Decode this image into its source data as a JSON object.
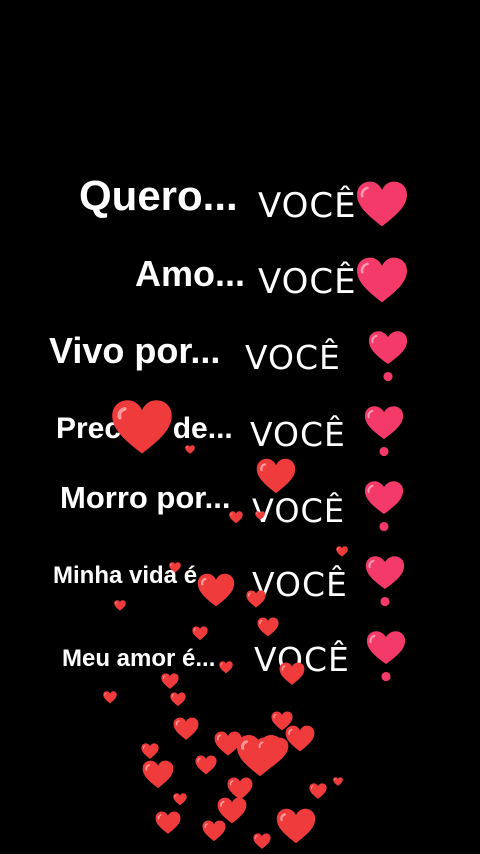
{
  "colors": {
    "background": "#000000",
    "text": "#ffffff",
    "heart_pink": "#f43a68",
    "heart_red": "#ef3b3b"
  },
  "lines": [
    {
      "lead": "Quero...",
      "word": "VOCÊ",
      "icon": "pink-heart"
    },
    {
      "lead": "Amo...",
      "word": "VOCÊ",
      "icon": "pink-heart"
    },
    {
      "lead": "Vivo por...",
      "word": "VOCÊ",
      "icon": "heart-exclamation"
    },
    {
      "lead": "Preciso de...",
      "word": "VOCÊ",
      "icon": "heart-exclamation"
    },
    {
      "lead": "Morro por...",
      "word": "VOCÊ",
      "icon": "heart-exclamation"
    },
    {
      "lead": "Minha vida é..",
      "word": "VOCÊ",
      "icon": "heart-exclamation"
    },
    {
      "lead": "Meu amor é...",
      "word": "VOCÊ",
      "icon": "heart-exclamation"
    }
  ],
  "floating_hearts_icon": "red-heart"
}
